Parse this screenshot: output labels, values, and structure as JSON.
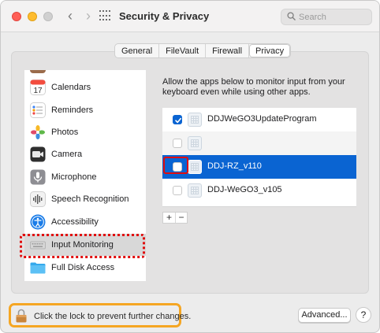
{
  "window": {
    "title": "Security & Privacy",
    "search": {
      "placeholder": "Search",
      "value": ""
    }
  },
  "tabs": [
    {
      "label": "General"
    },
    {
      "label": "FileVault"
    },
    {
      "label": "Firewall"
    },
    {
      "label": "Privacy",
      "active": true
    }
  ],
  "sidebar": {
    "items": [
      {
        "label": "Calendars",
        "icon": "calendar-icon",
        "icon_text": "17"
      },
      {
        "label": "Reminders",
        "icon": "reminders-icon"
      },
      {
        "label": "Photos",
        "icon": "photos-icon"
      },
      {
        "label": "Camera",
        "icon": "camera-icon"
      },
      {
        "label": "Microphone",
        "icon": "microphone-icon"
      },
      {
        "label": "Speech Recognition",
        "icon": "speech-recognition-icon"
      },
      {
        "label": "Accessibility",
        "icon": "accessibility-icon"
      },
      {
        "label": "Input Monitoring",
        "icon": "keyboard-icon",
        "selected": true
      },
      {
        "label": "Full Disk Access",
        "icon": "folder-icon"
      }
    ]
  },
  "main": {
    "description": "Allow the apps below to monitor input from your keyboard even while using other apps.",
    "apps": [
      {
        "name": "DDJWeGO3UpdateProgram",
        "checked": true
      },
      {
        "name": "",
        "checked": false
      },
      {
        "name": "DDJ-RZ_v110",
        "checked": false,
        "selected": true
      },
      {
        "name": "DDJ-WeGO3_v105",
        "checked": false
      }
    ],
    "add_label": "+",
    "remove_label": "−"
  },
  "footer": {
    "lock_text": "Click the lock to prevent further changes.",
    "advanced_label": "Advanced...",
    "help_label": "?"
  },
  "colors": {
    "accent": "#0a64d2",
    "highlight_red": "#e00d0d",
    "highlight_orange": "#f5a623"
  }
}
